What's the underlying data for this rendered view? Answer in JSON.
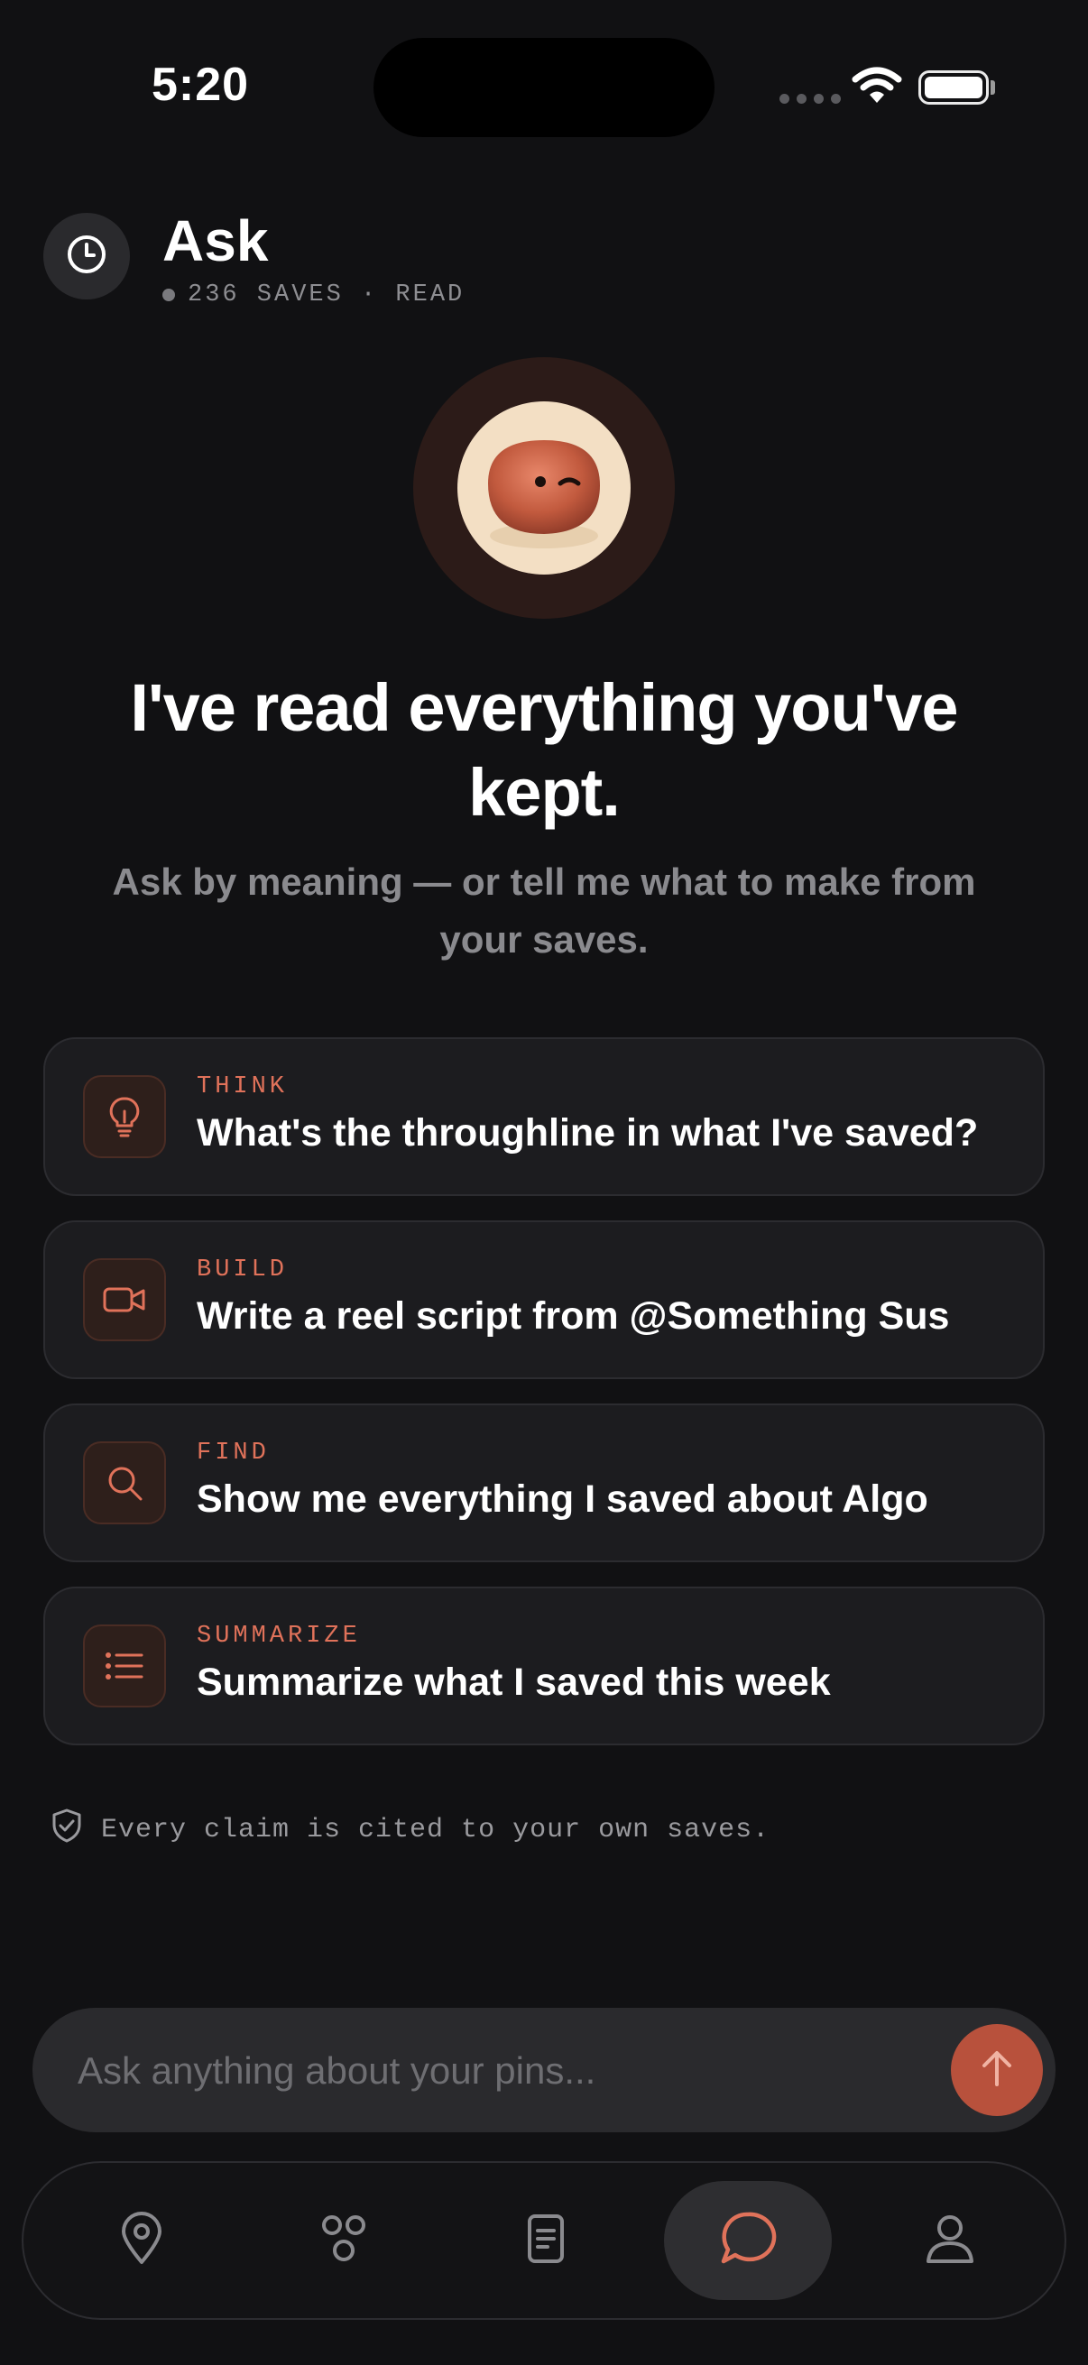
{
  "status_bar": {
    "time": "5:20"
  },
  "header": {
    "title": "Ask",
    "meta": "236 SAVES · READ"
  },
  "hero": {
    "headline": "I've read everything you've kept.",
    "subtitle": "Ask by meaning — or tell me what to make from your saves."
  },
  "suggestions": [
    {
      "tag": "THINK",
      "prompt": "What's the throughline in what I've saved?",
      "icon": "lightbulb-icon"
    },
    {
      "tag": "BUILD",
      "prompt": "Write a reel script from @Something Sus",
      "icon": "video-icon"
    },
    {
      "tag": "FIND",
      "prompt": "Show me everything I saved about Algo",
      "icon": "search-icon"
    },
    {
      "tag": "SUMMARIZE",
      "prompt": "Summarize what I saved this week",
      "icon": "list-icon"
    }
  ],
  "citation_note": "Every claim is cited to your own saves.",
  "input": {
    "placeholder": "Ask anything about your pins..."
  },
  "tabs": [
    {
      "name": "map",
      "icon": "location-pin-icon",
      "active": false
    },
    {
      "name": "collections",
      "icon": "cluster-icon",
      "active": false
    },
    {
      "name": "notes",
      "icon": "document-icon",
      "active": false
    },
    {
      "name": "ask",
      "icon": "chat-bubble-icon",
      "active": true
    },
    {
      "name": "profile",
      "icon": "person-icon",
      "active": false
    }
  ],
  "colors": {
    "accent": "#e0725a",
    "send_button": "#b8513c",
    "background": "#111113",
    "card": "#1c1c1f"
  }
}
